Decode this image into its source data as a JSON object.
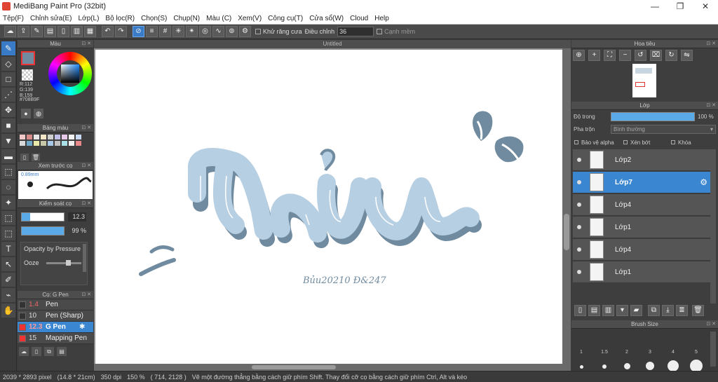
{
  "window": {
    "title": "MediBang Paint Pro (32bit)",
    "minimize": "—",
    "restore": "❐",
    "close": "✕"
  },
  "menu": [
    "Tệp(F)",
    "Chỉnh sửa(E)",
    "Lớp(L)",
    "Bộ lọc(R)",
    "Chọn(S)",
    "Chụp(N)",
    "Màu (C)",
    "Xem(V)",
    "Công cụ(T)",
    "Cửa sổ(W)",
    "Cloud",
    "Help"
  ],
  "toolbar": {
    "antialias_label": "Khử răng cưa",
    "adjust_label": "Điều chỉnh",
    "adjust_value": "36",
    "smooth_label": "Cạnh mềm"
  },
  "color_panel": {
    "title": "Màu",
    "r": "R:112",
    "g": "G:139",
    "b": "B:159",
    "hex": "#708B9F",
    "main_color": "#708b9f"
  },
  "palette_panel": {
    "title": "Bảng màu",
    "swatches": [
      "#f1c9c9",
      "#d88b8b",
      "#e6e6e6",
      "#f4e6c8",
      "#cfcfcf",
      "#bfbfe8",
      "#e6c8e8",
      "#f2f2f2",
      "#c8d8f0",
      "#d9d9d9",
      "#6fa8c8",
      "#e8e8a8",
      "#c8c8a8",
      "#a8c8e8",
      "#c0c0c0",
      "#a8e0e8",
      "#f0f0f0",
      "#e88888"
    ]
  },
  "preview_panel": {
    "title": "Xem trước cọ",
    "size": "0.89mm"
  },
  "brush_control": {
    "title": "Kiểm soát cọ",
    "size_value": "12.3",
    "opacity_value": "99 %",
    "pressure_label": "Opacity by Pressure",
    "ooze_label": "Ooze"
  },
  "brush_list": {
    "title": "Cọ: G Pen",
    "items": [
      {
        "size": "1.4",
        "name": "Pen",
        "color": false
      },
      {
        "size": "10",
        "name": "Pen (Sharp)",
        "color": false
      },
      {
        "size": "12.3",
        "name": "G Pen",
        "color": true,
        "selected": true
      },
      {
        "size": "15",
        "name": "Mapping Pen",
        "color": true
      }
    ]
  },
  "canvas": {
    "title": "Untitled",
    "signature": "Bủu20210 Đ&247"
  },
  "navigator": {
    "title": "Hoa tiêu"
  },
  "layer_panel": {
    "title": "Lớp",
    "opacity_label": "Độ trong",
    "opacity_value": "100 %",
    "blend_label": "Pha trộn",
    "blend_value": "Bình thường",
    "protect_alpha": "Bảo vệ alpha",
    "clipping": "Xén bớt",
    "lock": "Khóa",
    "layers": [
      {
        "name": "Lớp2",
        "selected": false
      },
      {
        "name": "Lớp7",
        "selected": true
      },
      {
        "name": "Lớp4",
        "selected": false
      },
      {
        "name": "Lớp1",
        "selected": false
      },
      {
        "name": "Lớp4",
        "selected": false
      },
      {
        "name": "Lớp1",
        "selected": false
      }
    ]
  },
  "brush_size_panel": {
    "title": "Brush Size",
    "sizes": [
      "1",
      "1.5",
      "2",
      "3",
      "4",
      "5"
    ]
  },
  "status": {
    "pixels": "2039 * 2893 pixel",
    "cm": "(14.8 * 21cm)",
    "dpi": "350 dpi",
    "zoom": "150 %",
    "coords": "( 714, 2128 )",
    "hint": "Vẽ một đường thẳng bằng cách giữ phím Shift. Thay đổi cỡ cọ bằng cách giữ phím Ctrl, Alt và kéo"
  }
}
